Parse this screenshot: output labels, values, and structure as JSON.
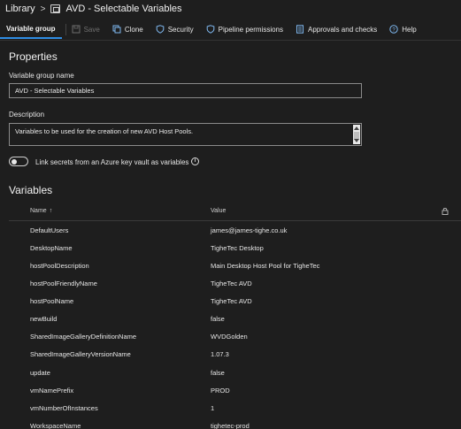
{
  "breadcrumb": {
    "root": "Library",
    "separator": ">",
    "current": "AVD - Selectable Variables"
  },
  "toolbar": {
    "active_tab": "Variable group",
    "buttons": [
      {
        "label": "Save",
        "icon": "save-icon",
        "enabled": false
      },
      {
        "label": "Clone",
        "icon": "clone-icon",
        "enabled": true
      },
      {
        "label": "Security",
        "icon": "shield-icon",
        "enabled": true
      },
      {
        "label": "Pipeline permissions",
        "icon": "shield-icon",
        "enabled": true
      },
      {
        "label": "Approvals and checks",
        "icon": "checklist-icon",
        "enabled": true
      },
      {
        "label": "Help",
        "icon": "help-icon",
        "enabled": true
      }
    ]
  },
  "properties": {
    "title": "Properties",
    "name_label": "Variable group name",
    "name_value": "AVD - Selectable Variables",
    "description_label": "Description",
    "description_value": "Variables to be used for the creation of new AVD Host Pools.",
    "keyvault_label": "Link secrets from an Azure key vault as variables",
    "keyvault_enabled": false,
    "info_glyph": "i"
  },
  "variables": {
    "title": "Variables",
    "columns": {
      "name": "Name",
      "sort_glyph": "↑",
      "value": "Value"
    },
    "rows": [
      {
        "name": "DefaultUsers",
        "value": "james@james-tighe.co.uk"
      },
      {
        "name": "DesktopName",
        "value": "TigheTec Desktop"
      },
      {
        "name": "hostPoolDescription",
        "value": "Main Desktop Host Pool for TigheTec"
      },
      {
        "name": "hostPoolFriendlyName",
        "value": "TigheTec AVD"
      },
      {
        "name": "hostPoolName",
        "value": "TigheTec AVD"
      },
      {
        "name": "newBuild",
        "value": "false"
      },
      {
        "name": "SharedImageGalleryDefinitionName",
        "value": "WVDGolden"
      },
      {
        "name": "SharedImageGalleryVersionName",
        "value": "1.07.3"
      },
      {
        "name": "update",
        "value": "false"
      },
      {
        "name": "vmNamePrefix",
        "value": "PROD"
      },
      {
        "name": "vmNumberOfInstances",
        "value": "1"
      },
      {
        "name": "WorkspaceName",
        "value": "tighetec-prod"
      }
    ]
  },
  "colors": {
    "background": "#1e1e1e",
    "accent": "#2f8de4",
    "text": "#e6e6e6"
  }
}
